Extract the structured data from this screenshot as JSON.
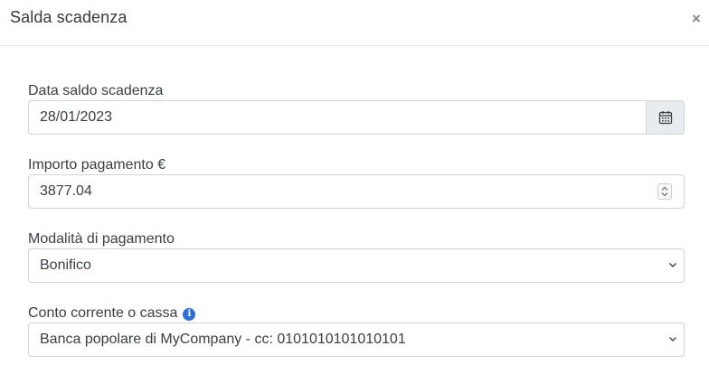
{
  "modal": {
    "title": "Salda scadenza",
    "close_icon": "close-icon"
  },
  "fields": {
    "data_saldo": {
      "label": "Data saldo scadenza",
      "value": "28/01/2023",
      "icon": "calendar-icon"
    },
    "importo": {
      "label": "Importo pagamento €",
      "value": "3877.04",
      "icon": "spinner-icon"
    },
    "modalita": {
      "label": "Modalità di pagamento",
      "selected": "Bonifico",
      "icon": "chevron-down-icon"
    },
    "conto": {
      "label": "Conto corrente o cassa",
      "info_icon": "info-icon",
      "info_glyph": "i",
      "selected": "Banca popolare di MyCompany - cc: 0101010101010101",
      "icon": "chevron-down-icon"
    }
  },
  "colors": {
    "border": "#ced4da",
    "addon_bg": "#e9ecef",
    "info_blue": "#2f6fd6",
    "text": "#3a3f44"
  }
}
